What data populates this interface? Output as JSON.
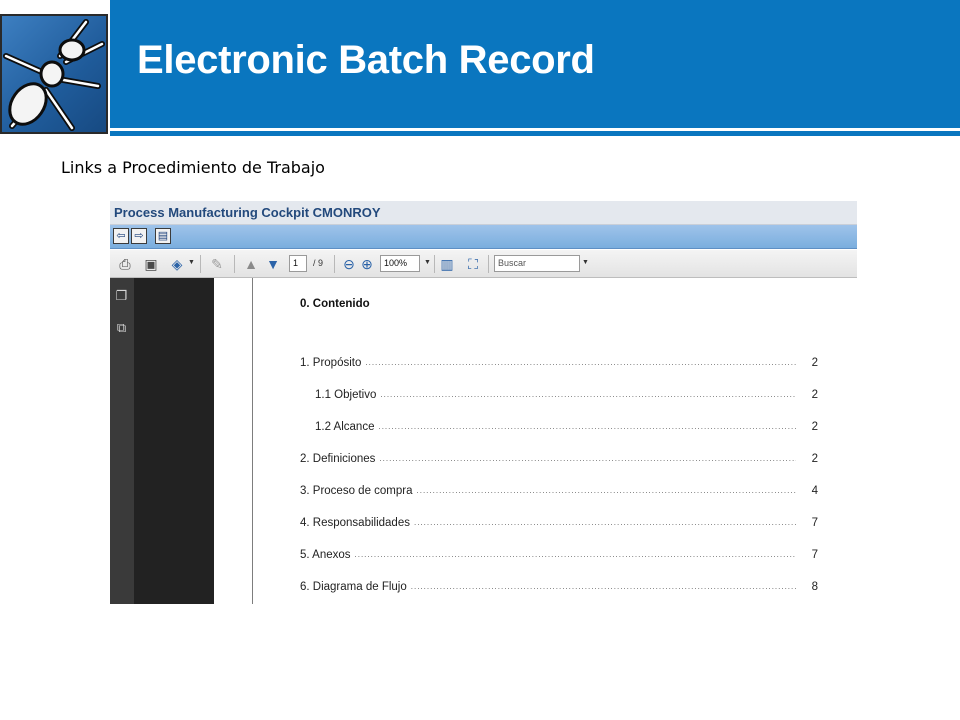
{
  "slide": {
    "title": "Electronic Batch Record",
    "subtitle": "Links a Procedimiento de Trabajo"
  },
  "app": {
    "window_title": "Process Manufacturing Cockpit CMONROY",
    "nav": {
      "back_icon": "arrow-left-icon",
      "forward_icon": "arrow-right-icon",
      "menu_icon": "display-menu-icon"
    },
    "pdf_toolbar": {
      "icons": [
        "print-icon",
        "save-icon",
        "share-icon",
        "comment-icon",
        "page-up-icon",
        "page-down-icon",
        "zoom-out-icon",
        "zoom-in-icon",
        "fit-page-icon",
        "full-screen-icon"
      ],
      "current_page": "1",
      "page_total": "/ 9",
      "zoom": "100%",
      "search_placeholder": "Buscar"
    }
  },
  "document": {
    "heading": "0. Contenido",
    "toc": [
      {
        "label": "1. Propósito",
        "page": "2",
        "indent": 0
      },
      {
        "label": "1.1 Objetivo",
        "page": "2",
        "indent": 1
      },
      {
        "label": "1.2 Alcance",
        "page": "2",
        "indent": 1
      },
      {
        "label": "2. Definiciones",
        "page": "2",
        "indent": 0
      },
      {
        "label": "3. Proceso de compra",
        "page": "4",
        "indent": 0
      },
      {
        "label": "4. Responsabilidades",
        "page": "7",
        "indent": 0
      },
      {
        "label": "5. Anexos",
        "page": "7",
        "indent": 0
      },
      {
        "label": "6. Diagrama de Flujo",
        "page": "8",
        "indent": 0
      }
    ]
  },
  "colors": {
    "banner": "#0a76bf",
    "sap_title_text": "#23497c",
    "nav_bar": "#7aaede"
  }
}
